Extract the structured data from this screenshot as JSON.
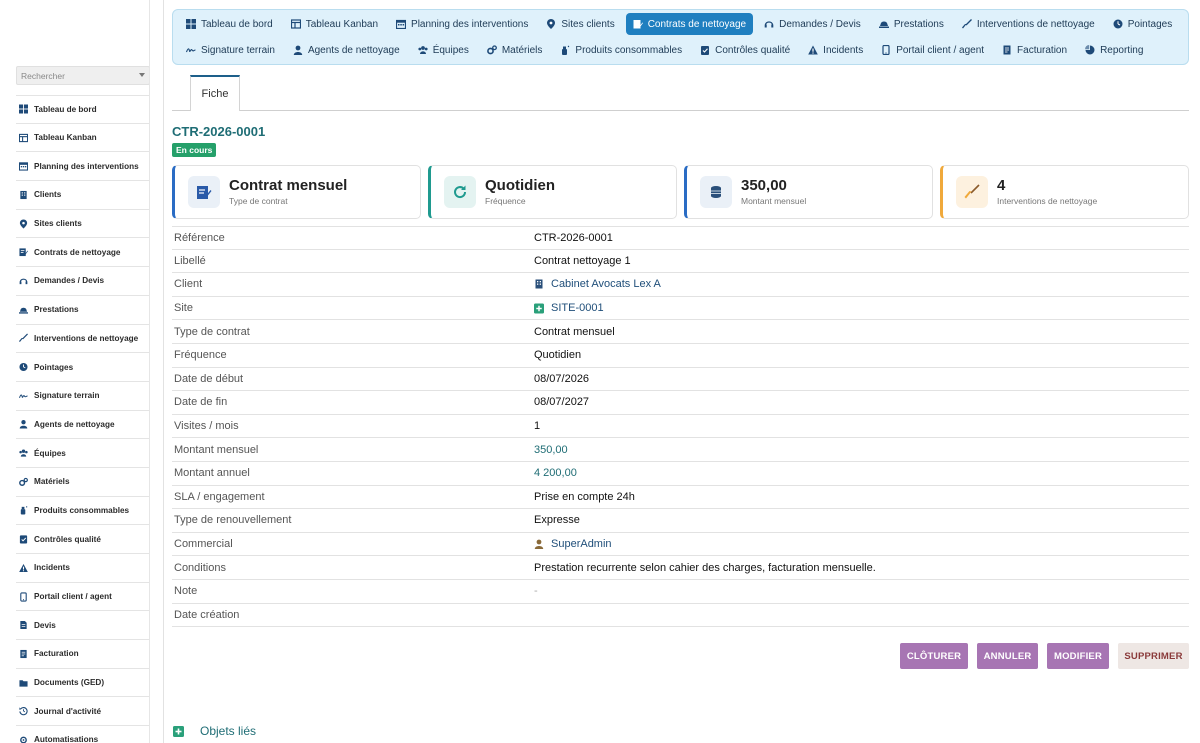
{
  "sidebar": {
    "search_placeholder": "Rechercher",
    "items": [
      {
        "label": "Tableau de bord",
        "icon": "dashboard-icon"
      },
      {
        "label": "Tableau Kanban",
        "icon": "kanban-icon"
      },
      {
        "label": "Planning des interventions",
        "icon": "calendar-icon"
      },
      {
        "label": "Clients",
        "icon": "building-icon"
      },
      {
        "label": "Sites clients",
        "icon": "map-pin-icon"
      },
      {
        "label": "Contrats de nettoyage",
        "icon": "contract-icon"
      },
      {
        "label": "Demandes / Devis",
        "icon": "headset-icon"
      },
      {
        "label": "Prestations",
        "icon": "service-icon"
      },
      {
        "label": "Interventions de nettoyage",
        "icon": "broom-icon"
      },
      {
        "label": "Pointages",
        "icon": "clock-icon"
      },
      {
        "label": "Signature terrain",
        "icon": "signature-icon"
      },
      {
        "label": "Agents de nettoyage",
        "icon": "user-icon"
      },
      {
        "label": "Équipes",
        "icon": "team-icon"
      },
      {
        "label": "Matériels",
        "icon": "cogs-icon"
      },
      {
        "label": "Produits consommables",
        "icon": "spray-icon"
      },
      {
        "label": "Contrôles qualité",
        "icon": "clipboard-check-icon"
      },
      {
        "label": "Incidents",
        "icon": "warning-icon"
      },
      {
        "label": "Portail client / agent",
        "icon": "mobile-icon"
      },
      {
        "label": "Devis",
        "icon": "document-icon"
      },
      {
        "label": "Facturation",
        "icon": "invoice-icon"
      },
      {
        "label": "Documents (GED)",
        "icon": "folder-icon"
      },
      {
        "label": "Journal d'activité",
        "icon": "history-icon"
      },
      {
        "label": "Automatisations",
        "icon": "automation-icon"
      }
    ]
  },
  "topmenu": {
    "row1": [
      {
        "label": "Tableau de bord",
        "icon": "dashboard-icon"
      },
      {
        "label": "Tableau Kanban",
        "icon": "kanban-icon"
      },
      {
        "label": "Planning des interventions",
        "icon": "calendar-icon"
      },
      {
        "label": "Sites clients",
        "icon": "map-pin-icon"
      },
      {
        "label": "Contrats de nettoyage",
        "icon": "contract-icon",
        "active": true
      },
      {
        "label": "Demandes / Devis",
        "icon": "headset-icon"
      },
      {
        "label": "Prestations",
        "icon": "service-icon"
      },
      {
        "label": "Interventions de nettoyage",
        "icon": "broom-icon"
      },
      {
        "label": "Pointages",
        "icon": "clock-icon"
      }
    ],
    "row2": [
      {
        "label": "Signature terrain",
        "icon": "signature-icon"
      },
      {
        "label": "Agents de nettoyage",
        "icon": "user-icon"
      },
      {
        "label": "Équipes",
        "icon": "team-icon"
      },
      {
        "label": "Matériels",
        "icon": "cogs-icon"
      },
      {
        "label": "Produits consommables",
        "icon": "spray-icon"
      },
      {
        "label": "Contrôles qualité",
        "icon": "clipboard-check-icon"
      },
      {
        "label": "Incidents",
        "icon": "warning-icon"
      },
      {
        "label": "Portail client / agent",
        "icon": "mobile-icon"
      },
      {
        "label": "Facturation",
        "icon": "invoice-icon"
      },
      {
        "label": "Reporting",
        "icon": "chart-pie-icon"
      }
    ]
  },
  "tabs": {
    "fiche": "Fiche"
  },
  "record": {
    "title": "CTR-2026-0001",
    "status": "En cours"
  },
  "cards": [
    {
      "value": "Contrat mensuel",
      "label": "Type de contrat",
      "icon": "contract-icon",
      "accent": "#2a6cc4"
    },
    {
      "value": "Quotidien",
      "label": "Fréquence",
      "icon": "refresh-icon",
      "accent": "#1f9a8f"
    },
    {
      "value": "350,00",
      "label": "Montant mensuel",
      "icon": "coins-icon",
      "accent": "#2a6cc4"
    },
    {
      "value": "4",
      "label": "Interventions de nettoyage",
      "icon": "broom-icon",
      "accent": "#f0a93b"
    }
  ],
  "details": [
    {
      "key": "Référence",
      "value": "CTR-2026-0001"
    },
    {
      "key": "Libellé",
      "value": "Contrat nettoyage 1"
    },
    {
      "key": "Client",
      "value": "Cabinet Avocats Lex A",
      "icon": "building-icon",
      "link": true
    },
    {
      "key": "Site",
      "value": "SITE-0001",
      "icon": "site-plus-icon",
      "link": true
    },
    {
      "key": "Type de contrat",
      "value": "Contrat mensuel"
    },
    {
      "key": "Fréquence",
      "value": "Quotidien"
    },
    {
      "key": "Date de début",
      "value": "08/07/2026"
    },
    {
      "key": "Date de fin",
      "value": "08/07/2027"
    },
    {
      "key": "Visites / mois",
      "value": "1"
    },
    {
      "key": "Montant mensuel",
      "value": "350,00",
      "money": true
    },
    {
      "key": "Montant annuel",
      "value": "4 200,00",
      "money": true
    },
    {
      "key": "SLA / engagement",
      "value": "Prise en compte 24h"
    },
    {
      "key": "Type de renouvellement",
      "value": "Expresse"
    },
    {
      "key": "Commercial",
      "value": "SuperAdmin",
      "icon": "user-icon",
      "link": true
    },
    {
      "key": "Conditions",
      "value": "Prestation recurrente selon cahier des charges, facturation mensuelle."
    },
    {
      "key": "Note",
      "value": "-",
      "muted": true
    },
    {
      "key": "Date création",
      "value": ""
    }
  ],
  "actions": {
    "cloturer": "CLÔTURER",
    "annuler": "ANNULER",
    "modifier": "MODIFIER",
    "supprimer": "SUPPRIMER"
  },
  "linked": {
    "label": "Objets liés"
  },
  "colors": {
    "accent": "#1f7fc0",
    "title": "#1f6d75",
    "badge": "#25a06a",
    "button": "#a775b3"
  }
}
